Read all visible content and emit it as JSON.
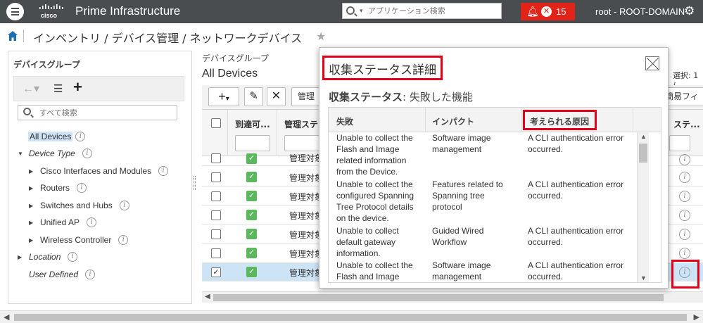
{
  "header": {
    "app_title": "Prime Infrastructure",
    "brand": "cisco",
    "search_placeholder": "アプリケーション検索",
    "alarm_count": "15",
    "user": "root - ROOT-DOMAIN",
    "colors": {
      "bar": "#4a4d50",
      "alarm": "#e2231a",
      "highlight": "#e3001b"
    }
  },
  "breadcrumb": {
    "text": "インベントリ / デバイス管理 / ネットワークデバイス"
  },
  "left_panel": {
    "title": "デバイスグループ",
    "search_placeholder": "すべて検索",
    "items": [
      {
        "label": "All Devices",
        "selected": true
      },
      {
        "label": "Device Type",
        "expanded": true
      },
      {
        "label": "Cisco Interfaces and Modules"
      },
      {
        "label": "Routers"
      },
      {
        "label": "Switches and Hubs"
      },
      {
        "label": "Unified AP"
      },
      {
        "label": "Wireless Controller"
      },
      {
        "label": "Location"
      },
      {
        "label": "User Defined"
      }
    ]
  },
  "main": {
    "group_label": "デバイスグループ",
    "title": "All Devices",
    "selected_info": "選択: 1 /",
    "toolbar": {
      "manage_label": "管理",
      "quick_filter": "簡易フィ"
    },
    "columns": {
      "reachability": "到達可...",
      "admin_status": "管理ステ",
      "collection_status": "ステ..."
    },
    "rows": [
      {
        "admin": "管理対象",
        "checked": false
      },
      {
        "admin": "管理対象",
        "checked": false
      },
      {
        "admin": "管理対象",
        "checked": false
      },
      {
        "admin": "管理対象",
        "checked": false
      },
      {
        "admin": "管理対象",
        "checked": false
      },
      {
        "admin": "管理対象",
        "checked": false
      },
      {
        "admin": "管理対象",
        "checked": true
      }
    ]
  },
  "popup": {
    "title": "収集ステータス詳細",
    "subtitle_bold": "収集ステータス",
    "subtitle_rest": ": 失敗した機能",
    "columns": {
      "failure": "失敗",
      "impact": "インパクト",
      "cause": "考えられる原因"
    },
    "rows": [
      {
        "failure": "Unable to collect the Flash and Image related information from the Device.",
        "impact": "Software image management",
        "cause": "A CLI authentication error occurred."
      },
      {
        "failure": "Unable to collect the configured Spanning Tree Protocol details on the device.",
        "impact": "Features related to Spanning tree protocol",
        "cause": "A CLI authentication error occurred."
      },
      {
        "failure": "Unable to collect default gateway information.",
        "impact": "Guided Wired Workflow",
        "cause": "A CLI authentication error occurred."
      },
      {
        "failure": "Unable to collect the Flash and Image",
        "impact": "Software image management",
        "cause": "A CLI authentication error occurred."
      }
    ]
  }
}
